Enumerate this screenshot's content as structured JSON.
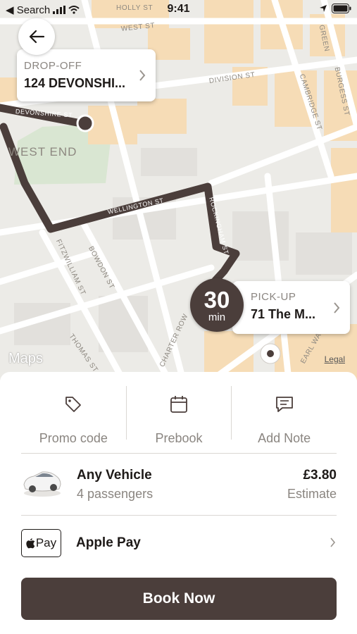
{
  "status_bar": {
    "back_label": "◀ Search",
    "time": "9:41"
  },
  "map": {
    "district": "WEST END",
    "streets": {
      "devonshire": "DEVONSHIRE ST",
      "west": "WEST ST",
      "division": "DIVISION ST",
      "wellington": "WELLINGTON ST",
      "rockingham": "ROCKINGHAM ST",
      "fitzwilliam": "FITZWILLIAM ST",
      "bowdon": "BOWDON ST",
      "thomas": "THOMAS ST",
      "charter": "CHARTER ROW",
      "cambridge": "CAMBRIDGE ST",
      "burgess": "BURGESS ST",
      "earl": "EARL WAY",
      "holly": "HOLLY ST",
      "green": "GREEN"
    },
    "maps_label": "Maps",
    "legal_label": "Legal"
  },
  "dropoff": {
    "label": "DROP-OFF",
    "address": "124 DEVONSHI..."
  },
  "pickup": {
    "label": "PICK-UP",
    "address": "71 The M..."
  },
  "eta": {
    "value": "30",
    "unit": "min"
  },
  "actions": [
    {
      "label": "Promo code",
      "icon": "tag-icon"
    },
    {
      "label": "Prebook",
      "icon": "calendar-icon"
    },
    {
      "label": "Add Note",
      "icon": "note-icon"
    }
  ],
  "vehicle": {
    "name": "Any Vehicle",
    "passengers": "4 passengers",
    "price": "£3.80",
    "price_note": "Estimate"
  },
  "payment": {
    "badge": "Pay",
    "method": "Apple Pay"
  },
  "book_button": "Book Now",
  "colors": {
    "accent": "#4b3e3b",
    "route": "#4b3e3b",
    "building": "#f6dcb6"
  }
}
